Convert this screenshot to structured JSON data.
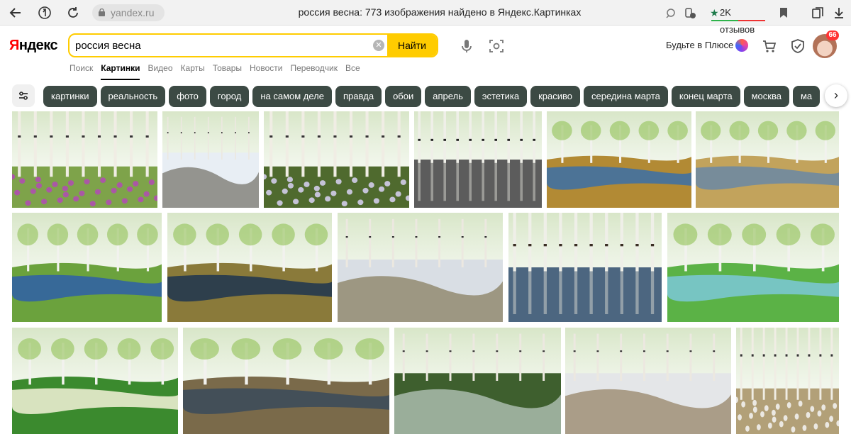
{
  "browser": {
    "url": "yandex.ru",
    "title": "россия весна: 773 изображения найдено в Яндекс.Картинках",
    "reviews": "2K отзывов"
  },
  "header": {
    "logo_first": "Я",
    "logo_rest": "ндекс",
    "search_value": "россия весна",
    "find_label": "Найти",
    "plus_label": "Будьте в Плюсе",
    "notifications": "66"
  },
  "tabs": [
    {
      "label": "Поиск"
    },
    {
      "label": "Картинки",
      "active": true
    },
    {
      "label": "Видео"
    },
    {
      "label": "Карты"
    },
    {
      "label": "Товары"
    },
    {
      "label": "Новости"
    },
    {
      "label": "Переводчик"
    },
    {
      "label": "Все"
    }
  ],
  "chips": [
    "картинки",
    "реальность",
    "фото",
    "город",
    "на самом деле",
    "правда",
    "обои",
    "апрель",
    "эстетика",
    "красиво",
    "середина марта",
    "конец марта",
    "москва",
    "ма"
  ],
  "images": [
    {
      "name": "image-birch-forest-purple-flowers",
      "scene": "forest-flowers",
      "sky": "#d8e6c8",
      "ground": "#7ea34a",
      "accent": "#b24bb5"
    },
    {
      "name": "image-snow-meltwater-birch",
      "scene": "snow",
      "sky": "#6f9ad6",
      "ground": "#e8eef4",
      "accent": "#4f4a3c"
    },
    {
      "name": "image-forest-snowdrops",
      "scene": "forest-flowers",
      "sky": "#c7b56c",
      "ground": "#4f6a2e",
      "accent": "#d9d2f4"
    },
    {
      "name": "image-flooded-birch-reflection",
      "scene": "flood",
      "sky": "#e9e9e9",
      "ground": "#5c5c5c",
      "accent": "#222222"
    },
    {
      "name": "image-birch-pond-blue-sky",
      "scene": "meadow-water",
      "sky": "#6fb2e0",
      "ground": "#b28a34",
      "accent": "#3a6fa8"
    },
    {
      "name": "image-clouds-field-river",
      "scene": "meadow-water",
      "sky": "#4f8ed6",
      "ground": "#c2a35c",
      "accent": "#6a88a5"
    },
    {
      "name": "image-birch-branches-lake",
      "scene": "lake",
      "sky": "#2f7fd8",
      "ground": "#6ba23d",
      "accent": "#2e5fa8"
    },
    {
      "name": "image-stream-trees-sunset",
      "scene": "meadow-water",
      "sky": "#5b8bc9",
      "ground": "#8a7a3a",
      "accent": "#1d3550"
    },
    {
      "name": "image-snowy-path-river",
      "scene": "snow",
      "sky": "#4a8bd6",
      "ground": "#d9dee4",
      "accent": "#6b5c32"
    },
    {
      "name": "image-flooded-birch-grove",
      "scene": "flood",
      "sky": "#d6dde4",
      "ground": "#4c6680",
      "accent": "#3a2e24"
    },
    {
      "name": "image-green-park-pond",
      "scene": "lake",
      "sky": "#a9c9e8",
      "ground": "#5bb246",
      "accent": "#7cc8d8"
    },
    {
      "name": "image-river-hills-snowdrop-flowers",
      "scene": "lake",
      "sky": "#c9d9a8",
      "ground": "#3b8a2e",
      "accent": "#f4f2d8"
    },
    {
      "name": "image-sunset-river-grass",
      "scene": "meadow-water",
      "sky": "#e8906a",
      "ground": "#7a6a4a",
      "accent": "#3a4a5a"
    },
    {
      "name": "image-ice-floes-lake",
      "scene": "snow",
      "sky": "#a7c8e6",
      "ground": "#3e5f2e",
      "accent": "#e6eef4"
    },
    {
      "name": "image-birch-melted-snow",
      "scene": "snow",
      "sky": "#c8d9ea",
      "ground": "#e4e6e8",
      "accent": "#7a6038"
    },
    {
      "name": "image-birch-grove-spring",
      "scene": "forest-flowers",
      "sky": "#d9e4ec",
      "ground": "#b2a078",
      "accent": "#f4f4f4"
    }
  ]
}
